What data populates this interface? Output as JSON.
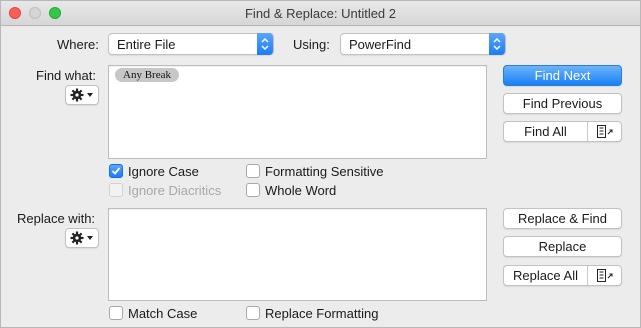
{
  "window": {
    "title": "Find & Replace: Untitled 2"
  },
  "where": {
    "label": "Where:",
    "value": "Entire File"
  },
  "using": {
    "label": "Using:",
    "value": "PowerFind"
  },
  "find": {
    "label": "Find what:",
    "token": "Any Break"
  },
  "replace": {
    "label": "Replace with:"
  },
  "options": {
    "ignore_case": {
      "label": "Ignore Case",
      "checked": true
    },
    "ignore_diacritics": {
      "label": "Ignore Diacritics",
      "checked": false,
      "disabled": true
    },
    "formatting_sensitive": {
      "label": "Formatting Sensitive",
      "checked": false
    },
    "whole_word": {
      "label": "Whole Word",
      "checked": false
    },
    "match_case": {
      "label": "Match Case",
      "checked": false
    },
    "replace_formatting": {
      "label": "Replace Formatting",
      "checked": false
    }
  },
  "buttons": {
    "find_next": "Find Next",
    "find_previous": "Find Previous",
    "find_all": "Find All",
    "replace_find": "Replace & Find",
    "replace": "Replace",
    "replace_all": "Replace All"
  },
  "colors": {
    "accent": "#1a80f5",
    "close": "#fc5f57",
    "maximize": "#34c84a",
    "token_bg": "#c7c7c7"
  }
}
